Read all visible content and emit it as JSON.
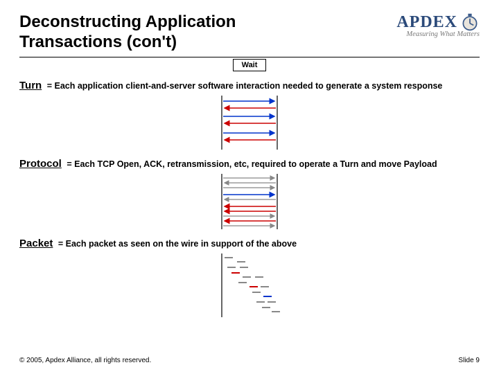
{
  "title": "Deconstructing Application Transactions (con't)",
  "logo": {
    "name": "APDEX",
    "tagline": "Measuring What Matters",
    "clock_icon": "stopwatch-icon"
  },
  "wait_label": "Wait",
  "sections": {
    "turn": {
      "term": "Turn",
      "def": "= Each application client-and-server software interaction needed to generate a system response"
    },
    "protocol": {
      "term": "Protocol",
      "def": "= Each TCP Open, ACK, retransmission, etc, required to operate a Turn and move Payload"
    },
    "packet": {
      "term": "Packet",
      "def": "= Each packet as seen on the wire in support of the above"
    }
  },
  "footer": {
    "copyright": "© 2005, Apdex Alliance, all rights reserved.",
    "slide": "Slide 9"
  },
  "colors": {
    "blue": "#0033cc",
    "red": "#cc0000",
    "grey": "#888888",
    "axis": "#000000"
  }
}
